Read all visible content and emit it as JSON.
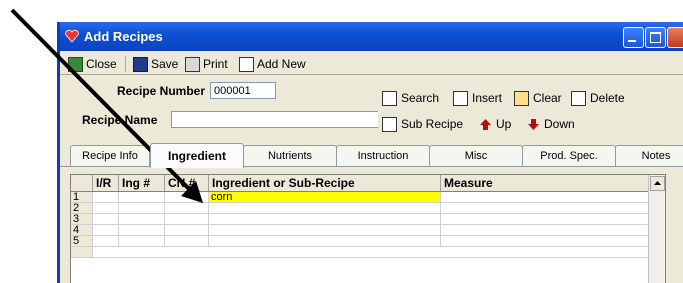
{
  "window": {
    "title": "Add Recipes"
  },
  "toolbar": {
    "close": "Close",
    "save": "Save",
    "print": "Print",
    "add_new": "Add New"
  },
  "form": {
    "recipe_number_label": "Recipe Number",
    "recipe_number_value": "000001",
    "recipe_name_label": "Recipe Name",
    "recipe_name_value": ""
  },
  "actions": {
    "search": "Search",
    "insert": "Insert",
    "clear": "Clear",
    "delete": "Delete",
    "sub_recipe": "Sub Recipe",
    "up": "Up",
    "down": "Down"
  },
  "tabs": [
    "Recipe Info",
    "Ingredient",
    "Nutrients",
    "Instruction",
    "Misc",
    "Prod. Spec.",
    "Notes"
  ],
  "active_tab": "Ingredient",
  "grid": {
    "columns": [
      "I/R",
      "Ing #",
      "CN #",
      "Ingredient or Sub-Recipe",
      "Measure"
    ],
    "rows": [
      {
        "num": "1",
        "ingredient": "corn"
      },
      {
        "num": "2",
        "ingredient": ""
      },
      {
        "num": "3",
        "ingredient": ""
      },
      {
        "num": "4",
        "ingredient": ""
      },
      {
        "num": "5",
        "ingredient": ""
      }
    ]
  },
  "colors": {
    "titlebar": "#0c4fd4",
    "highlight": "#ffff00",
    "arrow": "#000000"
  }
}
